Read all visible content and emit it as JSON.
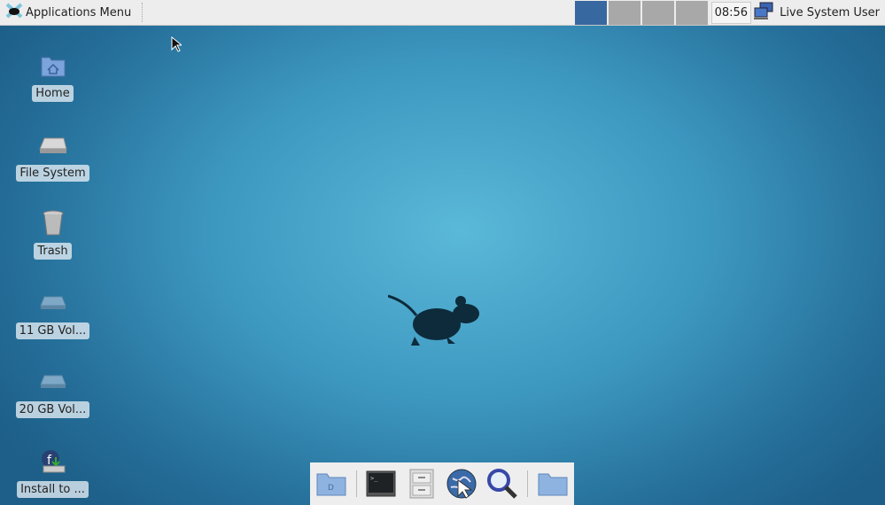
{
  "panel": {
    "app_menu_label": "Applications Menu",
    "workspaces": [
      {
        "active": true
      },
      {
        "active": false
      },
      {
        "active": false
      },
      {
        "active": false
      }
    ],
    "clock": "08:56",
    "user": "Live System User"
  },
  "desktop_icons": [
    {
      "label": "Home",
      "icon": "home-folder-icon"
    },
    {
      "label": "File System",
      "icon": "drive-icon"
    },
    {
      "label": "Trash",
      "icon": "trash-icon"
    },
    {
      "label": "11 GB Vol...",
      "icon": "drive-icon"
    },
    {
      "label": "20 GB Vol...",
      "icon": "drive-icon"
    },
    {
      "label": "Install to ...",
      "icon": "installer-icon"
    }
  ],
  "dock": [
    "show-desktop-icon",
    "terminal-icon",
    "file-cabinet-icon",
    "web-browser-icon",
    "search-icon",
    "folder-icon"
  ]
}
